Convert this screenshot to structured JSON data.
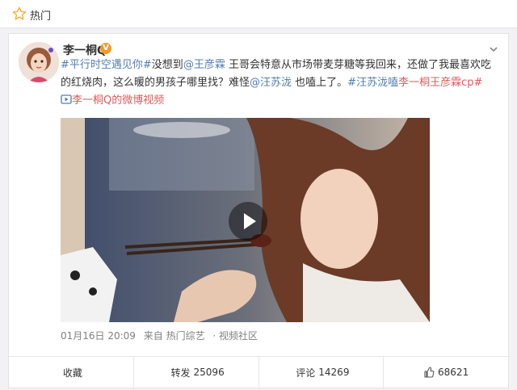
{
  "header": {
    "title": "热门",
    "icon": "star-icon"
  },
  "post": {
    "author": "李一桐Q",
    "verified_badge": "V",
    "text": {
      "topic1": "#平行时空遇见你#",
      "part1": "没想到",
      "mention1": "@王彦霖",
      "part2": " 王哥会特意从市场带麦芽糖等我回来，还做了我最喜欢吃的红烧肉，这么暖的男孩子哪里找？难怪",
      "mention2": "@汪苏泷",
      "part3": " 也嗑上了。",
      "topic2a": "#汪苏泷嗑",
      "topic2b": "李一桐王彦霖cp#",
      "link_icon": "video-link-icon",
      "link_text": "李一桐Q的微博视频"
    },
    "meta": {
      "time": "01月16日 20:09",
      "source": "来自 热门综艺",
      "tag": "· 视频社区"
    },
    "actions": {
      "collect": "收藏",
      "repost_label": "转发",
      "repost_count": "25096",
      "comment_label": "评论",
      "comment_count": "14269",
      "like_count": "68621"
    }
  },
  "colors": {
    "link": "#507daf",
    "highlight": "#e05b5b",
    "badge": "#f59a23"
  }
}
